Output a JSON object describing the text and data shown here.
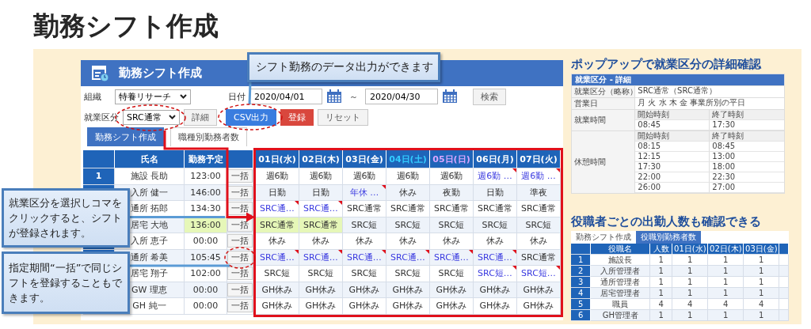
{
  "page_title": "勤務シフト作成",
  "app": {
    "title": "勤務シフト作成",
    "filters": {
      "org_label": "組織",
      "org_value": "特養リサーチ",
      "date_label": "日付",
      "date_from": "2020/04/01",
      "range_sep": "～",
      "date_to": "2020/04/30",
      "search_button": "検索",
      "type_label": "就業区分",
      "type_value": "SRC通常",
      "detail_button": "詳細",
      "csv_button": "CSV出力",
      "register_button": "登録",
      "reset_button": "リセット"
    },
    "tabs": [
      {
        "label": "勤務シフト作成",
        "selected": true
      },
      {
        "label": "職種別勤務者数",
        "selected": false
      }
    ],
    "table": {
      "name_header": "氏名",
      "plan_header": "勤務予定",
      "days": [
        {
          "label": "01日(水)",
          "kind": "weekday"
        },
        {
          "label": "02日(木)",
          "kind": "weekday"
        },
        {
          "label": "03日(金)",
          "kind": "weekday"
        },
        {
          "label": "04日(土)",
          "kind": "saturday"
        },
        {
          "label": "05日(日)",
          "kind": "sunday"
        },
        {
          "label": "06日(月)",
          "kind": "weekday"
        },
        {
          "label": "07日(火)",
          "kind": "weekday"
        }
      ],
      "rows": [
        {
          "no": "1",
          "name": "施設 長助",
          "plan": "123:00",
          "plan_highlight": false,
          "bulk": "一括",
          "cells": [
            {
              "text": "週6勤",
              "kind": "plain"
            },
            {
              "text": "週6勤",
              "kind": "plain"
            },
            {
              "text": "週6勤",
              "kind": "plain"
            },
            {
              "text": "週6勤",
              "kind": "plain"
            },
            {
              "text": "週6勤",
              "kind": "plain"
            },
            {
              "text": "週6勤 …",
              "kind": "note"
            },
            {
              "text": "週6勤 …",
              "kind": "note"
            }
          ]
        },
        {
          "name": "入所 健一",
          "plan": "146:00",
          "plan_highlight": false,
          "bulk": "一括",
          "cells": [
            {
              "text": "日勤",
              "kind": "plain"
            },
            {
              "text": "日勤",
              "kind": "plain"
            },
            {
              "text": "年休 …",
              "kind": "note"
            },
            {
              "text": "休み",
              "kind": "plain"
            },
            {
              "text": "夜勤",
              "kind": "plain"
            },
            {
              "text": "日勤",
              "kind": "plain"
            },
            {
              "text": "準夜",
              "kind": "plain"
            }
          ]
        },
        {
          "name": "通所 拓郎",
          "plan": "134:30",
          "plan_highlight": false,
          "bulk": "一括",
          "cells": [
            {
              "text": "SRC通…",
              "kind": "note"
            },
            {
              "text": "SRC通…",
              "kind": "note"
            },
            {
              "text": "SRC通常",
              "kind": "plain"
            },
            {
              "text": "SRC通常",
              "kind": "plain"
            },
            {
              "text": "SRC通常",
              "kind": "plain"
            },
            {
              "text": "SRC通常",
              "kind": "plain"
            },
            {
              "text": "SRC通常",
              "kind": "plain"
            }
          ]
        },
        {
          "name": "居宅 大地",
          "plan": "136:00",
          "plan_highlight": true,
          "bulk": "一括",
          "cells": [
            {
              "text": "SRC通常",
              "kind": "highlight"
            },
            {
              "text": "SRC通常",
              "kind": "highlight"
            },
            {
              "text": "SRC短",
              "kind": "plain"
            },
            {
              "text": "SRC短",
              "kind": "plain"
            },
            {
              "text": "SRC短",
              "kind": "plain"
            },
            {
              "text": "SRC短",
              "kind": "plain"
            },
            {
              "text": "SRC短",
              "kind": "plain"
            }
          ]
        },
        {
          "name": "入所 恵子",
          "plan": "00:00",
          "plan_highlight": false,
          "bulk": "一括",
          "cells": [
            {
              "text": "休み",
              "kind": "plain"
            },
            {
              "text": "休み",
              "kind": "plain"
            },
            {
              "text": "休み",
              "kind": "plain"
            },
            {
              "text": "休み",
              "kind": "plain"
            },
            {
              "text": "休み",
              "kind": "plain"
            },
            {
              "text": "休み",
              "kind": "plain"
            },
            {
              "text": "休み",
              "kind": "plain"
            }
          ]
        },
        {
          "name": "通所 希美",
          "plan": "105:45",
          "plan_highlight": false,
          "bulk": "一括",
          "cells": [
            {
              "text": "SRC通…",
              "kind": "note"
            },
            {
              "text": "SRC通…",
              "kind": "note"
            },
            {
              "text": "SRC通…",
              "kind": "note"
            },
            {
              "text": "SRC通…",
              "kind": "note"
            },
            {
              "text": "SRC通…",
              "kind": "note"
            },
            {
              "text": "SRC通…",
              "kind": "note"
            },
            {
              "text": "SRC通常",
              "kind": "plain"
            }
          ]
        },
        {
          "name": "居宅 翔子",
          "plan": "102:00",
          "plan_highlight": false,
          "bulk": "一括",
          "cells": [
            {
              "text": "SRC短",
              "kind": "plain"
            },
            {
              "text": "SRC短",
              "kind": "plain"
            },
            {
              "text": "SRC短",
              "kind": "plain"
            },
            {
              "text": "SRC短",
              "kind": "plain"
            },
            {
              "text": "SRC短",
              "kind": "plain"
            },
            {
              "text": "SRC短…",
              "kind": "note"
            },
            {
              "text": "SRC短…",
              "kind": "note"
            }
          ]
        },
        {
          "name": "GW 理恵",
          "plan": "00:00",
          "plan_highlight": false,
          "bulk": "一括",
          "cells": [
            {
              "text": "GH休み",
              "kind": "plain"
            },
            {
              "text": "GH休み",
              "kind": "plain"
            },
            {
              "text": "GH休み",
              "kind": "plain"
            },
            {
              "text": "GH休み",
              "kind": "plain"
            },
            {
              "text": "GH休み",
              "kind": "plain"
            },
            {
              "text": "GH休み",
              "kind": "plain"
            },
            {
              "text": "GH休み",
              "kind": "plain"
            }
          ]
        },
        {
          "name": "GH 純一",
          "plan": "00:00",
          "plan_highlight": false,
          "bulk": "一括",
          "cells": [
            {
              "text": "GH休み",
              "kind": "plain"
            },
            {
              "text": "GH休み",
              "kind": "plain"
            },
            {
              "text": "GH休み",
              "kind": "plain"
            },
            {
              "text": "GH休み",
              "kind": "plain"
            },
            {
              "text": "GH休み",
              "kind": "plain"
            },
            {
              "text": "GH休み",
              "kind": "plain"
            },
            {
              "text": "GH休み",
              "kind": "plain"
            }
          ]
        }
      ]
    }
  },
  "callouts": [
    {
      "text": "シフト勤務のデータ出力ができます"
    },
    {
      "text": "就業区分を選択しコマをクリックすると、シフトが登録されます。"
    },
    {
      "text": "指定期間“一括”で同じシフトを登録することもできます。"
    }
  ],
  "popup": {
    "heading": "ポップアップで就業区分の詳細確認",
    "title": "就業区分 - 詳細",
    "rows": [
      {
        "label": "就業区分（略称）",
        "value": "SRC通常（SRC通常）"
      },
      {
        "label": "営業日",
        "value": "月 火 水 木 金 事業所別の平日"
      }
    ],
    "times": [
      {
        "label": "就業時間",
        "start_header": "開始時刻",
        "end_header": "終了時刻",
        "periods": [
          {
            "start": "08:45",
            "end": "17:30"
          }
        ]
      },
      {
        "label": "休憩時間",
        "start_header": "開始時刻",
        "end_header": "終了時刻",
        "periods": [
          {
            "start": "08:15",
            "end": "08:45"
          },
          {
            "start": "12:15",
            "end": "13:00"
          },
          {
            "start": "17:30",
            "end": "18:00"
          },
          {
            "start": "22:00",
            "end": "22:30"
          },
          {
            "start": "26:00",
            "end": "27:00"
          }
        ]
      }
    ]
  },
  "staff_count": {
    "heading": "役職者ごとの出勤人数も確認できる",
    "tabs": [
      {
        "label": "勤務シフト作成",
        "selected": false
      },
      {
        "label": "役職別勤務者数",
        "selected": true
      }
    ],
    "columns": [
      "役職名",
      "人数",
      "01日(水)",
      "02日(木)",
      "03日(金)"
    ],
    "rows": [
      {
        "no": "1",
        "role": "施設長",
        "values": [
          "1",
          "1",
          "1",
          "1"
        ]
      },
      {
        "no": "2",
        "role": "入所管理者",
        "values": [
          "1",
          "1",
          "1",
          "1"
        ]
      },
      {
        "no": "3",
        "role": "通所管理者",
        "values": [
          "1",
          "1",
          "1",
          "1"
        ]
      },
      {
        "no": "4",
        "role": "居宅管理者",
        "values": [
          "1",
          "1",
          "1",
          "1"
        ]
      },
      {
        "no": "5",
        "role": "職員",
        "values": [
          "4",
          "4",
          "4",
          "4"
        ]
      },
      {
        "no": "6",
        "role": "GH管理者",
        "values": [
          "1",
          "1",
          "1",
          "1"
        ]
      }
    ]
  }
}
